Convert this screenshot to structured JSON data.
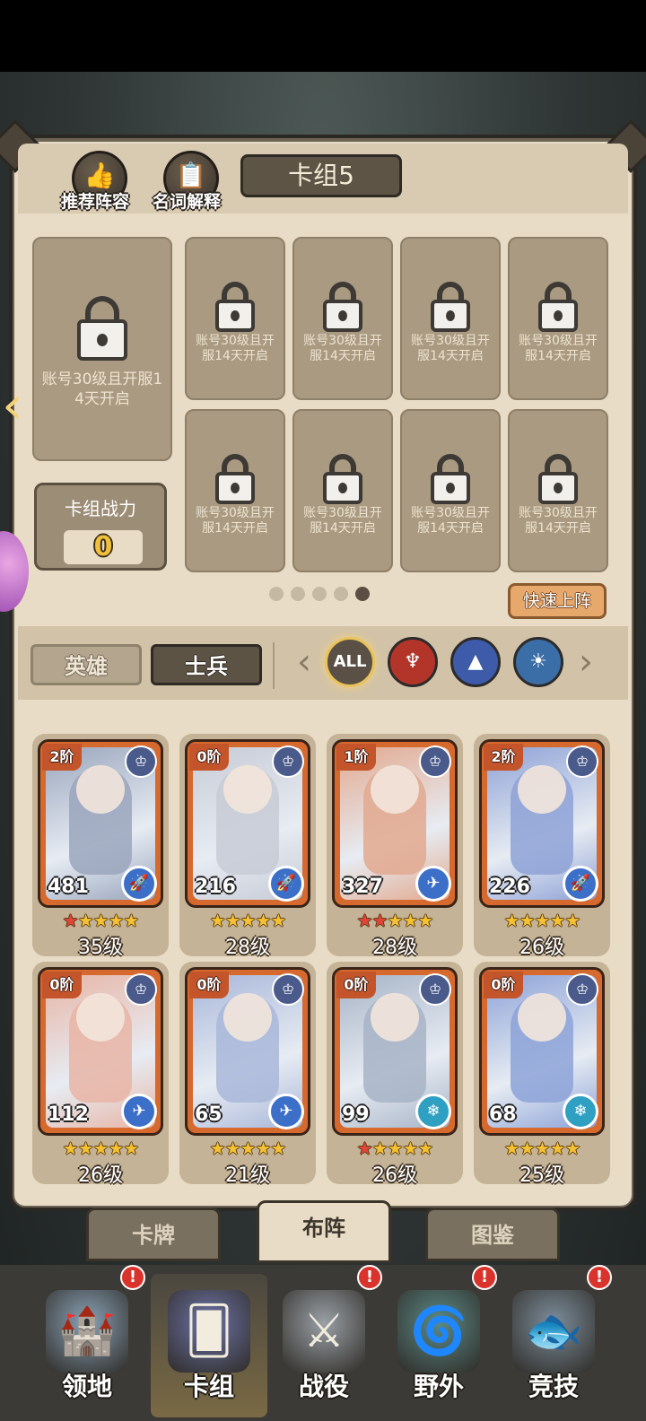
{
  "header": {
    "recommend_label": "推荐阵容",
    "glossary_label": "名词解释",
    "deck_title": "卡组5"
  },
  "slots": {
    "lock_text": "账号30级且开服14天开启"
  },
  "power": {
    "label": "卡组战力",
    "value": "0"
  },
  "pagination": {
    "total": 5,
    "active_index": 5
  },
  "quick_deploy_label": "快速上阵",
  "filters": {
    "tabs": [
      "英雄",
      "士兵"
    ],
    "active_tab": "士兵",
    "all_label": "ALL",
    "factions": [
      "demon-faction-icon",
      "mage-faction-icon",
      "kingdom-faction-icon"
    ]
  },
  "cards": [
    {
      "stage": "2阶",
      "power": "481",
      "level": "35级",
      "red_stars": 1,
      "stars": 5,
      "type": "sword",
      "art": "#9aa6bd"
    },
    {
      "stage": "0阶",
      "power": "216",
      "level": "28级",
      "red_stars": 0,
      "stars": 5,
      "type": "sword",
      "art": "#c7cbd6"
    },
    {
      "stage": "1阶",
      "power": "327",
      "level": "28级",
      "red_stars": 2,
      "stars": 5,
      "type": "plane",
      "art": "#e2a98f"
    },
    {
      "stage": "2阶",
      "power": "226",
      "level": "26级",
      "red_stars": 0,
      "stars": 5,
      "type": "sword",
      "art": "#8ea2d6"
    },
    {
      "stage": "0阶",
      "power": "112",
      "level": "26级",
      "red_stars": 0,
      "stars": 5,
      "type": "plane",
      "art": "#e7b5a6"
    },
    {
      "stage": "0阶",
      "power": "65",
      "level": "21级",
      "red_stars": 0,
      "stars": 5,
      "type": "plane",
      "art": "#a9b7d9"
    },
    {
      "stage": "0阶",
      "power": "99",
      "level": "26级",
      "red_stars": 1,
      "stars": 5,
      "type": "ice",
      "art": "#a7b4c7"
    },
    {
      "stage": "0阶",
      "power": "68",
      "level": "25级",
      "red_stars": 0,
      "stars": 5,
      "type": "ice",
      "art": "#8da3d8"
    }
  ],
  "subtabs": [
    "卡牌",
    "布阵",
    "图鉴"
  ],
  "active_subtab": "布阵",
  "nav": [
    {
      "label": "领地",
      "alert": true,
      "active": false,
      "icon": "castle-icon"
    },
    {
      "label": "卡组",
      "alert": false,
      "active": true,
      "icon": "cards-icon"
    },
    {
      "label": "战役",
      "alert": true,
      "active": false,
      "icon": "crossed-swords-icon"
    },
    {
      "label": "野外",
      "alert": true,
      "active": false,
      "icon": "portal-icon"
    },
    {
      "label": "竞技",
      "alert": true,
      "active": false,
      "icon": "fish-sword-icon"
    }
  ],
  "alert_symbol": "!"
}
